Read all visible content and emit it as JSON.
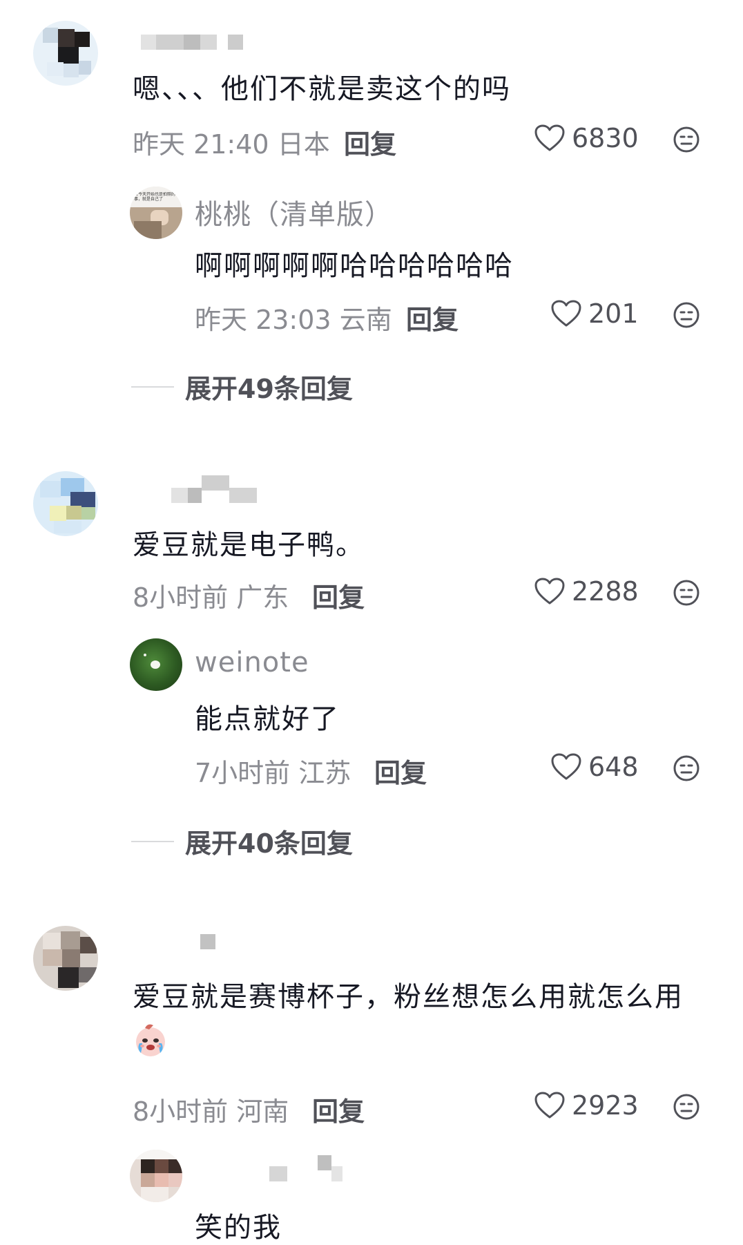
{
  "comments": [
    {
      "content": "嗯、、、他们不就是卖这个的吗",
      "time": "昨天 21:40",
      "location": "日本",
      "reply_label": "回复",
      "likes": "6830",
      "sub": {
        "username": "桃桃（清单版）",
        "avatar_text": "自今天开始也是拍照的事，就是自己了",
        "content": "啊啊啊啊啊哈哈哈哈哈哈",
        "time": "昨天 23:03",
        "location": "云南",
        "reply_label": "回复",
        "likes": "201"
      },
      "expand_label": "展开49条回复"
    },
    {
      "content": "爱豆就是电子鸭。",
      "time": "8小时前",
      "location": "广东",
      "reply_label": "回复",
      "likes": "2288",
      "sub": {
        "username": "weinote",
        "content": "能点就好了",
        "time": "7小时前",
        "location": "江苏",
        "reply_label": "回复",
        "likes": "648"
      },
      "expand_label": "展开40条回复"
    },
    {
      "content": "爱豆就是赛博杯子，粉丝想怎么用就怎么用",
      "time": "8小时前",
      "location": "河南",
      "reply_label": "回复",
      "likes": "2923",
      "sub": {
        "content": "笑的我"
      }
    }
  ],
  "colors": {
    "text_primary": "#161823",
    "text_secondary": "#8a8b91",
    "text_action": "#505158"
  },
  "icons": {
    "like": "heart-outline-icon",
    "dislike": "meh-face-icon",
    "emoji": "crying-baby-emoji"
  }
}
